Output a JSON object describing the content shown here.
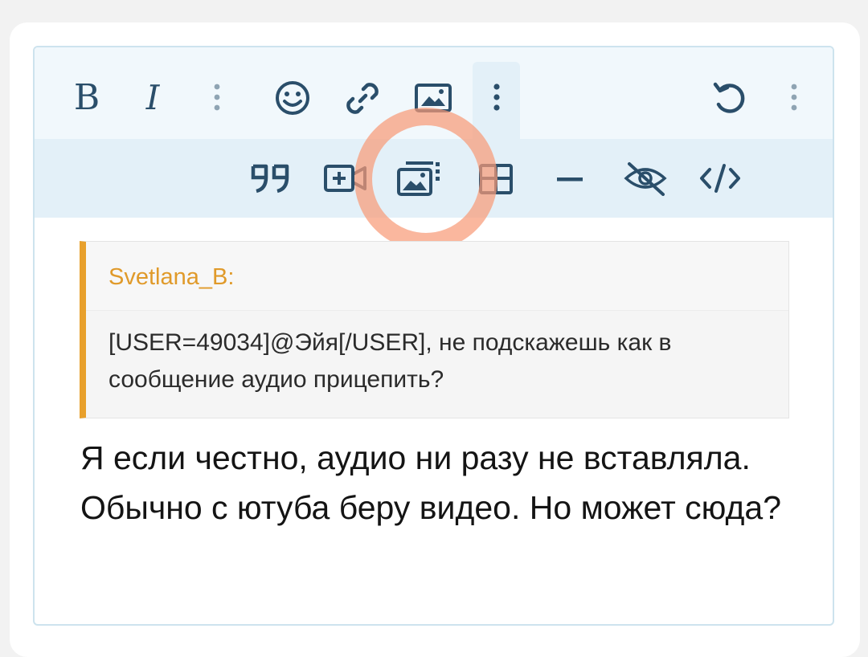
{
  "toolbar": {
    "row1": [
      {
        "name": "bold-button",
        "label": "B",
        "icon": "bold-icon"
      },
      {
        "name": "italic-button",
        "label": "I",
        "icon": "italic-icon"
      },
      {
        "name": "more-text-options-button",
        "icon": "vertical-dots-icon"
      },
      {
        "name": "insert-smilie-button",
        "icon": "smiley-icon"
      },
      {
        "name": "insert-link-button",
        "icon": "link-icon"
      },
      {
        "name": "insert-image-button",
        "icon": "image-icon"
      },
      {
        "name": "more-insert-options-button",
        "icon": "vertical-dots-icon",
        "active": true
      },
      {
        "name": "undo-button",
        "icon": "undo-icon"
      },
      {
        "name": "more-options-button",
        "icon": "vertical-dots-icon"
      }
    ],
    "row2": [
      {
        "name": "quote-button",
        "icon": "quote-icon"
      },
      {
        "name": "insert-media-button",
        "icon": "video-plus-icon"
      },
      {
        "name": "insert-gallery-button",
        "icon": "gallery-icon",
        "highlighted": true
      },
      {
        "name": "insert-table-button",
        "icon": "table-icon"
      },
      {
        "name": "horizontal-rule-button",
        "icon": "minus-icon"
      },
      {
        "name": "spoiler-button",
        "icon": "eye-slash-icon"
      },
      {
        "name": "code-button",
        "icon": "code-icon"
      }
    ]
  },
  "annotation": {
    "color": "#f89b78",
    "shape": "circle-around-gallery-button"
  },
  "quote": {
    "author": "Svetlana_B:",
    "text": "[USER=49034]@Эйя[/USER], не подскажешь как в сообщение аудио прицепить?"
  },
  "message": {
    "text": "Я если честно, аудио ни разу не вставляла. Обычно с ютуба беру видео. Но может сюда?"
  },
  "colors": {
    "toolbar_bg": "#f1f8fc",
    "toolbar_row2_bg": "#e3f0f8",
    "icon": "#2a4e6a",
    "quote_border": "#e8a02c",
    "quote_author": "#e09a2a"
  }
}
